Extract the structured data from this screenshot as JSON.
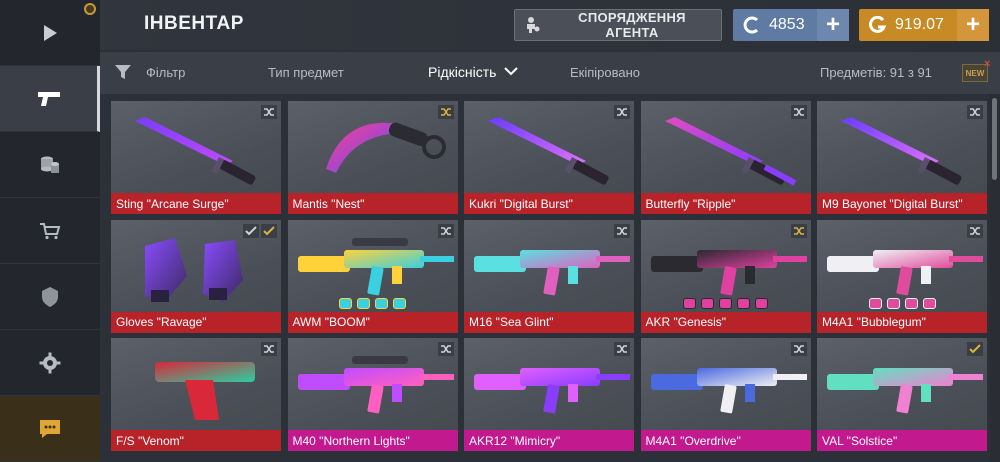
{
  "nav": {
    "items": [
      {
        "name": "play",
        "icon": "play-icon"
      },
      {
        "name": "inventory",
        "icon": "pistol-icon",
        "active": true
      },
      {
        "name": "case-opening",
        "icon": "coins-stack-icon"
      },
      {
        "name": "market",
        "icon": "cart-icon"
      },
      {
        "name": "clan",
        "icon": "shield-icon"
      },
      {
        "name": "settings",
        "icon": "gear-icon"
      },
      {
        "name": "chat",
        "icon": "chat-icon"
      }
    ]
  },
  "header": {
    "title": "ІНВЕНТАР",
    "agent_button": "СПОРЯДЖЕННЯ АГЕНТА",
    "coins": "4853",
    "gold": "919.07",
    "coin_symbol": "C",
    "gold_symbol": "G",
    "plus": "+"
  },
  "filterbar": {
    "filter": "Фільтр",
    "type": "Тип предмет",
    "rarity": "Рідкісність",
    "equipped": "Екіпіровано",
    "count": "Предметів: 91 з 91",
    "new_badge": "NEW"
  },
  "items": [
    {
      "name": "Sting \"Arcane Surge\"",
      "rarity": "covert",
      "kind": "knife",
      "colors": [
        "#7a3cff",
        "#c04cff"
      ],
      "ctrl": [
        "shuffle"
      ]
    },
    {
      "name": "Mantis \"Nest\"",
      "rarity": "covert",
      "kind": "karambit",
      "colors": [
        "#ff3f8f",
        "#5a4cff"
      ],
      "ctrl": [
        "shuffle-gold"
      ]
    },
    {
      "name": "Kukri \"Digital Burst\"",
      "rarity": "covert",
      "kind": "kukri",
      "colors": [
        "#6a3cff",
        "#e070ff"
      ],
      "ctrl": [
        "shuffle"
      ]
    },
    {
      "name": "Butterfly \"Ripple\"",
      "rarity": "covert",
      "kind": "butterfly",
      "colors": [
        "#e04cc0",
        "#8a3cff"
      ],
      "ctrl": [
        "shuffle"
      ]
    },
    {
      "name": "M9 Bayonet \"Digital Burst\"",
      "rarity": "covert",
      "kind": "bayonet",
      "colors": [
        "#6a3cff",
        "#e070ff"
      ],
      "ctrl": [
        "shuffle"
      ]
    },
    {
      "name": "Gloves \"Ravage\"",
      "rarity": "covert",
      "kind": "gloves",
      "colors": [
        "#8a4cff",
        "#3a2a60"
      ],
      "ctrl": [
        "check",
        "check-gold"
      ]
    },
    {
      "name": "AWM \"BOOM\"",
      "rarity": "covert",
      "kind": "sniper",
      "colors": [
        "#ffd23a",
        "#3ad0e0"
      ],
      "ctrl": [
        "shuffle"
      ],
      "stickers": 4
    },
    {
      "name": "M16 \"Sea Glint\"",
      "rarity": "covert",
      "kind": "rifle",
      "colors": [
        "#5ae0e0",
        "#e060c0"
      ],
      "ctrl": [
        "shuffle"
      ]
    },
    {
      "name": "AKR \"Genesis\"",
      "rarity": "covert",
      "kind": "ak",
      "colors": [
        "#2a2a30",
        "#e040a0"
      ],
      "ctrl": [
        "shuffle-gold"
      ],
      "stickers": 5
    },
    {
      "name": "M4A1 \"Bubblegum\"",
      "rarity": "covert",
      "kind": "m4",
      "colors": [
        "#f0f0f4",
        "#e04c9c"
      ],
      "ctrl": [
        "shuffle"
      ],
      "stickers": 4
    },
    {
      "name": "F/S \"Venom\"",
      "rarity": "covert",
      "kind": "pistol",
      "colors": [
        "#d8283a",
        "#2ad0a0"
      ],
      "ctrl": [
        "shuffle"
      ]
    },
    {
      "name": "M40 \"Northern Lights\"",
      "rarity": "classified",
      "kind": "sniper",
      "colors": [
        "#c04cff",
        "#ff60c0"
      ],
      "ctrl": [
        "shuffle"
      ]
    },
    {
      "name": "AKR12 \"Mimicry\"",
      "rarity": "classified",
      "kind": "ak12",
      "colors": [
        "#e060ff",
        "#8a3cff"
      ],
      "ctrl": [
        "shuffle"
      ]
    },
    {
      "name": "M4A1 \"Overdrive\"",
      "rarity": "classified",
      "kind": "m4",
      "colors": [
        "#4a6ae0",
        "#f0f0f4"
      ],
      "ctrl": [
        "shuffle"
      ]
    },
    {
      "name": "VAL \"Solstice\"",
      "rarity": "classified",
      "kind": "val",
      "colors": [
        "#60e0c0",
        "#f080d0"
      ],
      "ctrl": [
        "check-gold"
      ]
    }
  ]
}
